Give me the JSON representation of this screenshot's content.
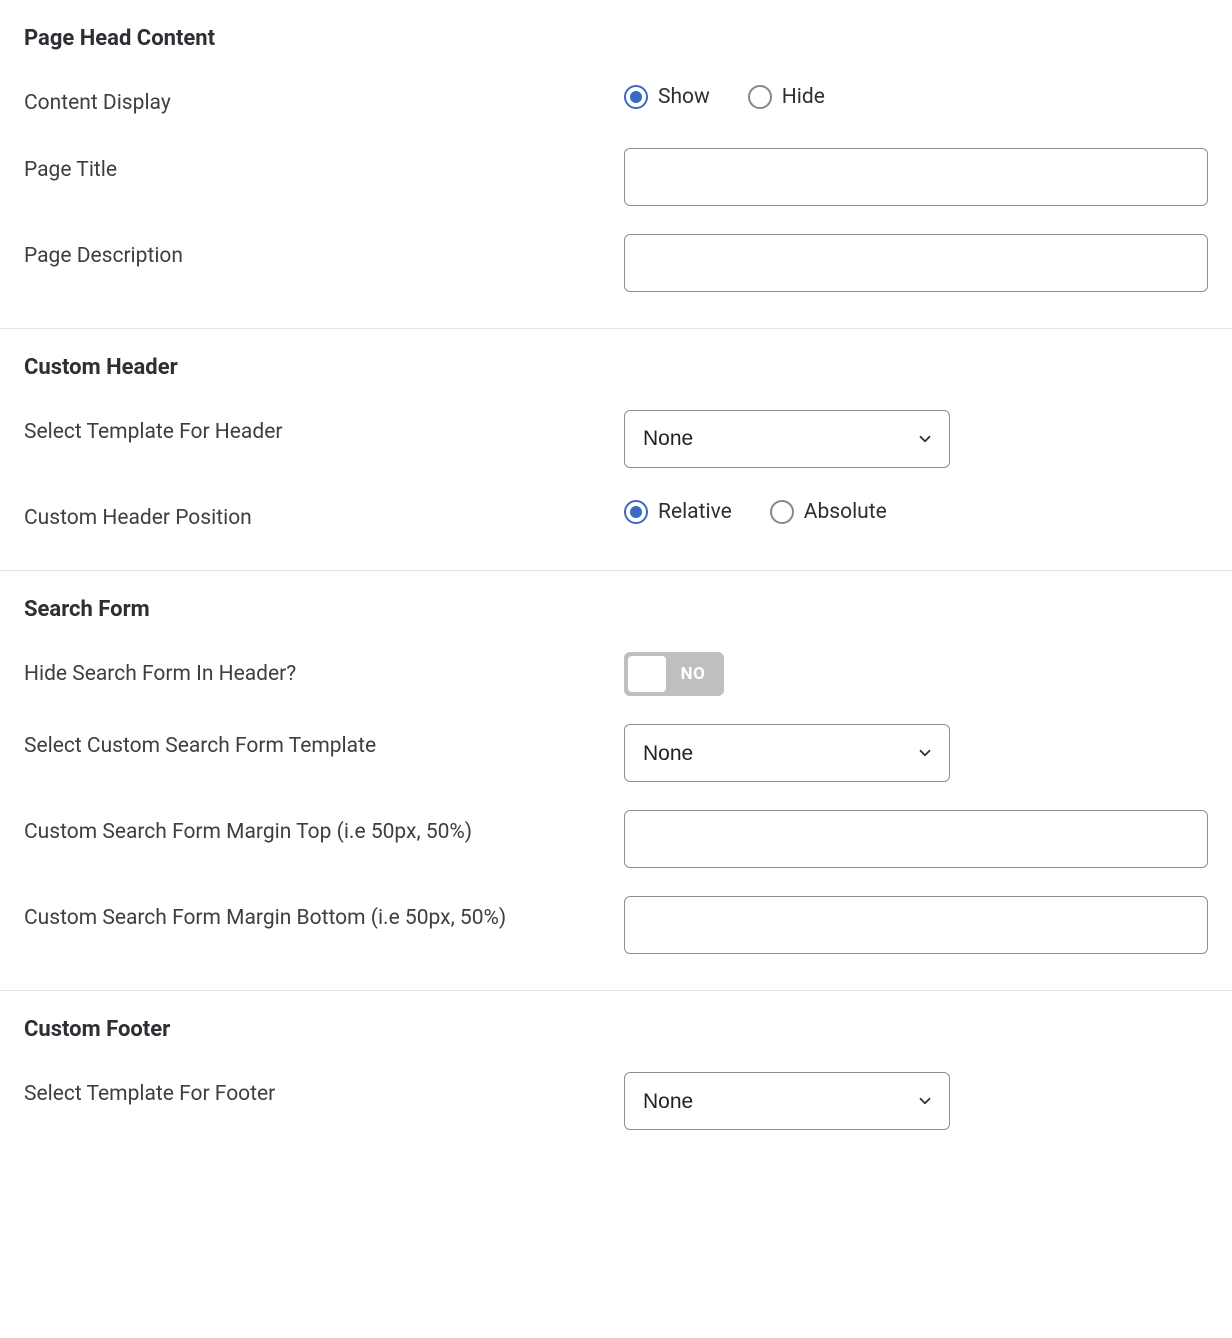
{
  "page_head": {
    "title": "Page Head Content",
    "content_display_label": "Content Display",
    "radio_show": "Show",
    "radio_hide": "Hide",
    "content_display_value": "show",
    "page_title_label": "Page Title",
    "page_title_value": "",
    "page_description_label": "Page Description",
    "page_description_value": ""
  },
  "custom_header": {
    "title": "Custom Header",
    "select_template_label": "Select Template For Header",
    "select_template_value": "None",
    "position_label": "Custom Header Position",
    "radio_relative": "Relative",
    "radio_absolute": "Absolute",
    "position_value": "relative"
  },
  "search_form": {
    "title": "Search Form",
    "hide_search_label": "Hide Search Form In Header?",
    "hide_search_toggle_value": false,
    "hide_search_toggle_text": "NO",
    "select_template_label": "Select Custom Search Form Template",
    "select_template_value": "None",
    "margin_top_label": "Custom Search Form Margin Top (i.e 50px, 50%)",
    "margin_top_value": "",
    "margin_bottom_label": "Custom Search Form Margin Bottom (i.e 50px, 50%)",
    "margin_bottom_value": ""
  },
  "custom_footer": {
    "title": "Custom Footer",
    "select_template_label": "Select Template For Footer",
    "select_template_value": "None"
  },
  "select_options": [
    "None"
  ]
}
